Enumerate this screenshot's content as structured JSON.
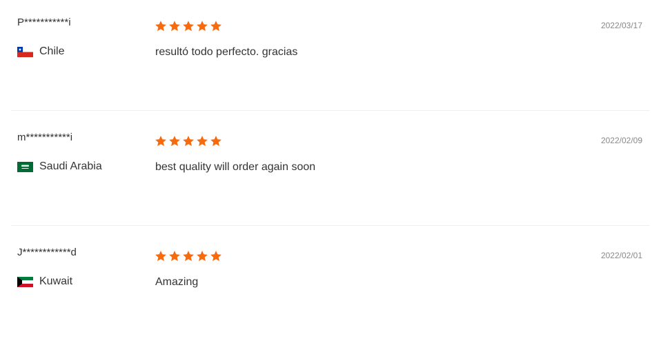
{
  "colors": {
    "star": "#f86a0e",
    "divider": "#eeeeee",
    "text": "#333333",
    "date": "#888888"
  },
  "reviews": [
    {
      "user": "P***********i",
      "country": "Chile",
      "flag_icon": "chile-flag-icon",
      "rating": 5,
      "comment": "resultó todo perfecto. gracias",
      "date": "2022/03/17"
    },
    {
      "user": "m***********i",
      "country": "Saudi Arabia",
      "flag_icon": "saudi-arabia-flag-icon",
      "rating": 5,
      "comment": "best quality will order again soon",
      "date": "2022/02/09"
    },
    {
      "user": "J************d",
      "country": "Kuwait",
      "flag_icon": "kuwait-flag-icon",
      "rating": 5,
      "comment": "Amazing",
      "date": "2022/02/01"
    }
  ]
}
